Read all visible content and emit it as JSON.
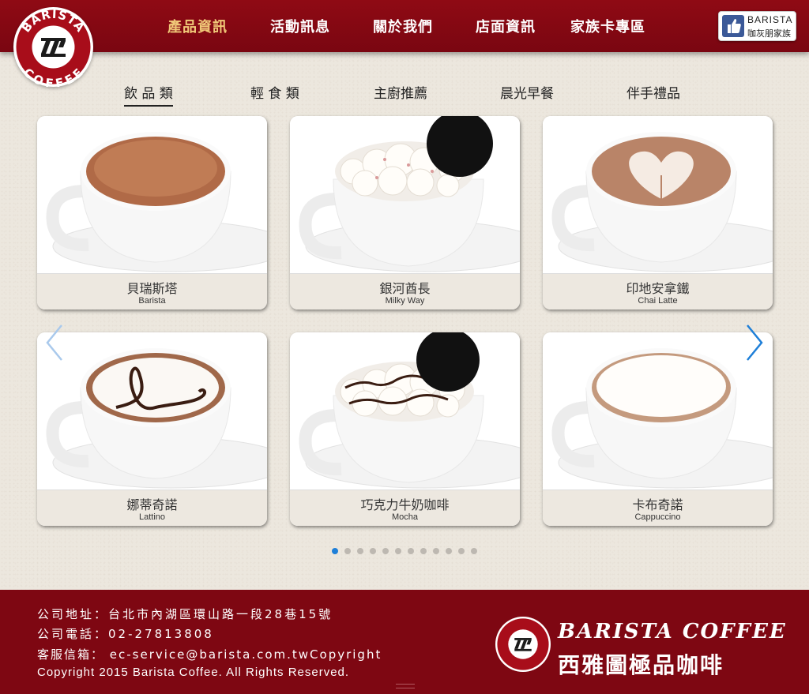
{
  "brand": {
    "logo_text_top": "BARISTA",
    "logo_text_bottom": "COFFEE"
  },
  "nav": [
    {
      "label": "產品資訊",
      "active": true
    },
    {
      "label": "活動訊息",
      "active": false
    },
    {
      "label": "關於我們",
      "active": false
    },
    {
      "label": "店面資訊",
      "active": false
    },
    {
      "label": "家族卡專區",
      "active": false
    }
  ],
  "facebook_badge": {
    "line1": "BARISTA",
    "line2": "咖灰朋家族",
    "icon": "thumbs-up-icon"
  },
  "categories": [
    {
      "label": "飲 品 類",
      "active": true
    },
    {
      "label": "輕 食 類",
      "active": false
    },
    {
      "label": "主廚推薦",
      "active": false
    },
    {
      "label": "晨光早餐",
      "active": false
    },
    {
      "label": "伴手禮品",
      "active": false
    }
  ],
  "products": [
    {
      "name": "貝瑞斯塔",
      "name_en": "Barista"
    },
    {
      "name": "銀河酋長",
      "name_en": "Milky Way"
    },
    {
      "name": "印地安拿鐵",
      "name_en": "Chai Latte"
    },
    {
      "name": "娜蒂奇諾",
      "name_en": "Lattino"
    },
    {
      "name": "巧克力牛奶咖啡",
      "name_en": "Mocha"
    },
    {
      "name": "卡布奇諾",
      "name_en": "Cappuccino"
    }
  ],
  "carousel": {
    "prev_icon": "chevron-left-icon",
    "next_icon": "chevron-right-icon",
    "page_count": 12,
    "active_page": 1
  },
  "footer": {
    "address": "公司地址：台北市內湖區環山路一段28巷15號",
    "phone": "公司電話：02-27813808",
    "email": "客服信箱： ec-service@barista.com.twCopyright",
    "copyright": "Copyright 2015 Barista Coffee. All Rights Reserved.",
    "brand_en": "BARISTA COFFEE",
    "brand_zh": "西雅圖極品咖啡"
  },
  "colors": {
    "header_red": "#8f0a14",
    "footer_red": "#7e0712",
    "nav_active": "#f0c878",
    "dot_active": "#1e7fd8",
    "arrow_blue": "#1e7fd8"
  }
}
